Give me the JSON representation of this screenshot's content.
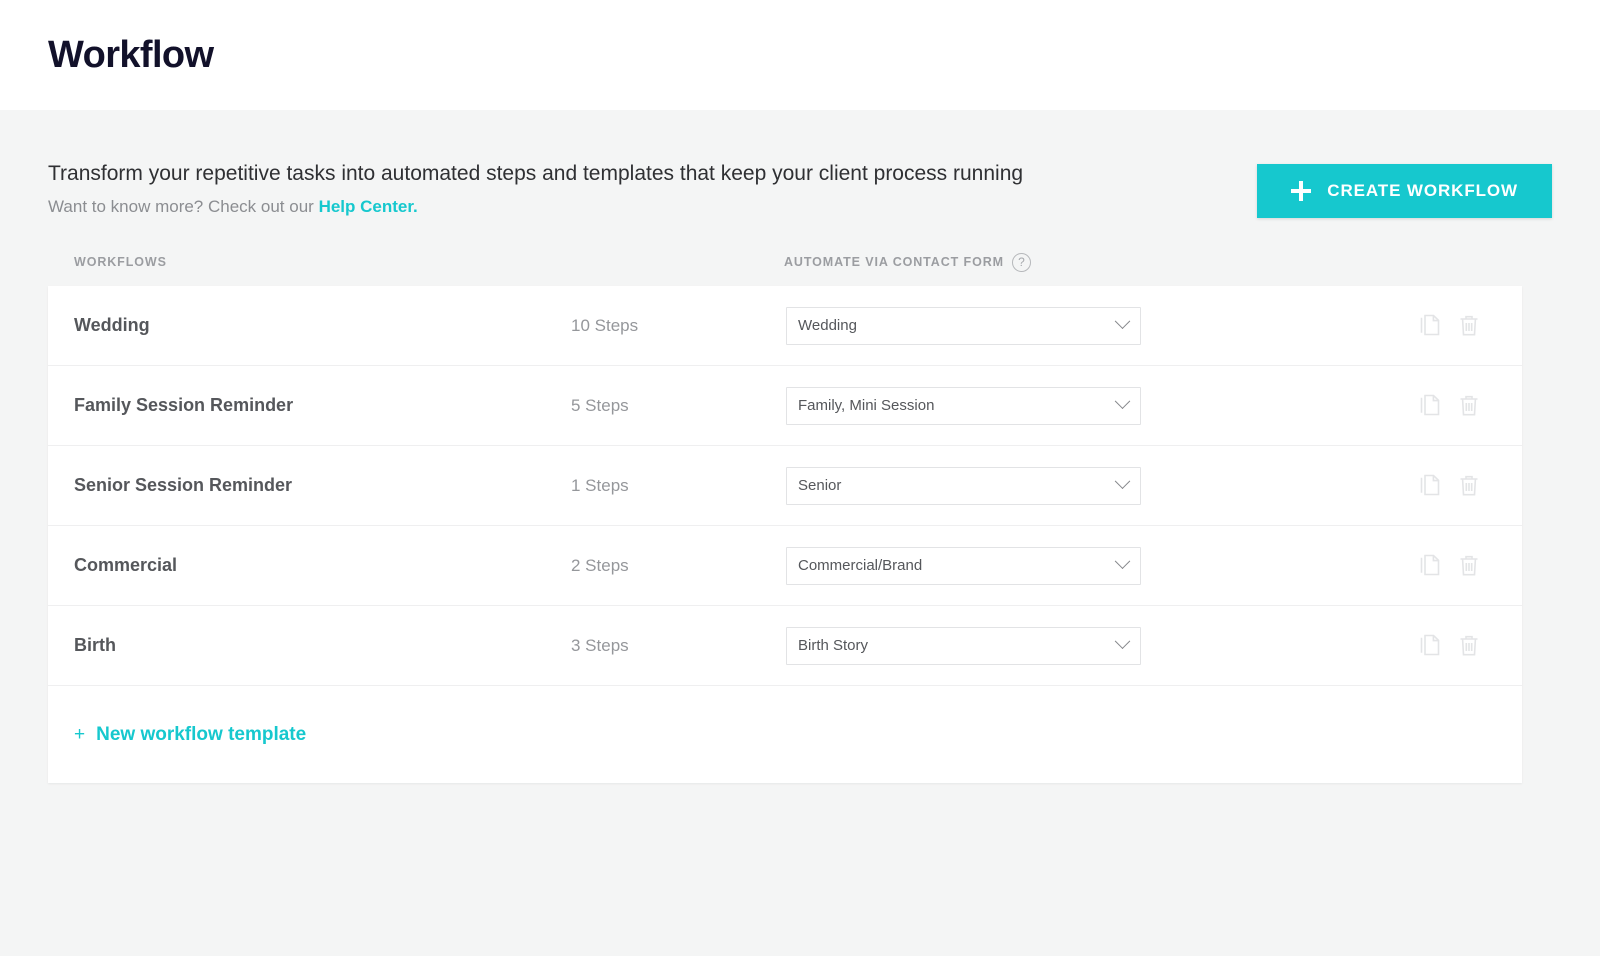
{
  "header": {
    "title": "Workflow"
  },
  "intro": {
    "description": "Transform your repetitive tasks into automated steps and templates that keep your client process running",
    "more_prefix": "Want to know more? Check out our ",
    "help_link_label": "Help Center."
  },
  "toolbar": {
    "create_workflow_label": "CREATE WORKFLOW",
    "plus_icon": "plus-icon"
  },
  "columns": {
    "workflows_label": "WORKFLOWS",
    "automate_label": "AUTOMATE VIA CONTACT FORM",
    "help_icon": "question-circle-icon",
    "help_icon_glyph": "?"
  },
  "rows": [
    {
      "name": "Wedding",
      "steps": "10 Steps",
      "contact_form": "Wedding",
      "duplicate_icon": "duplicate-icon",
      "delete_icon": "trash-icon"
    },
    {
      "name": "Family Session Reminder",
      "steps": "5 Steps",
      "contact_form": "Family, Mini Session",
      "duplicate_icon": "duplicate-icon",
      "delete_icon": "trash-icon"
    },
    {
      "name": "Senior Session Reminder",
      "steps": "1 Steps",
      "contact_form": "Senior",
      "duplicate_icon": "duplicate-icon",
      "delete_icon": "trash-icon"
    },
    {
      "name": "Commercial",
      "steps": "2 Steps",
      "contact_form": "Commercial/Brand",
      "duplicate_icon": "duplicate-icon",
      "delete_icon": "trash-icon"
    },
    {
      "name": "Birth",
      "steps": "3 Steps",
      "contact_form": "Birth Story",
      "duplicate_icon": "duplicate-icon",
      "delete_icon": "trash-icon"
    }
  ],
  "footer": {
    "new_template_plus": "+",
    "new_template_label": "New workflow template"
  },
  "colors": {
    "accent": "#16c8ce",
    "page_bg": "#f4f5f5",
    "card_bg": "#ffffff",
    "title": "#12112a",
    "muted_text": "#95979b"
  }
}
